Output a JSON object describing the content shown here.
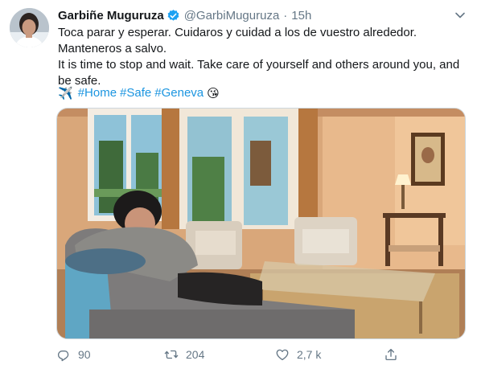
{
  "tweet": {
    "author_name": "Garbiñe Muguruza",
    "handle": "@GarbiMuguruza",
    "separator": "·",
    "time": "15h",
    "text_lines": [
      "Toca parar y esperar. Cuidaros y cuidad a los de vuestro alrededor.",
      "Manteneros a salvo.",
      "It is time to stop and wait. Take care of yourself and others around you, and",
      "be safe."
    ],
    "airplane_emoji": "✈️",
    "hashtags": [
      "#Home",
      "#Safe",
      "#Geneva"
    ],
    "kiss_emoji": "😘"
  },
  "actions": {
    "reply_count": "90",
    "retweet_count": "204",
    "like_count": "2,7 k"
  },
  "colors": {
    "accent": "#1b95e0",
    "secondary_text": "#657786",
    "verified": "#1da1f2"
  }
}
